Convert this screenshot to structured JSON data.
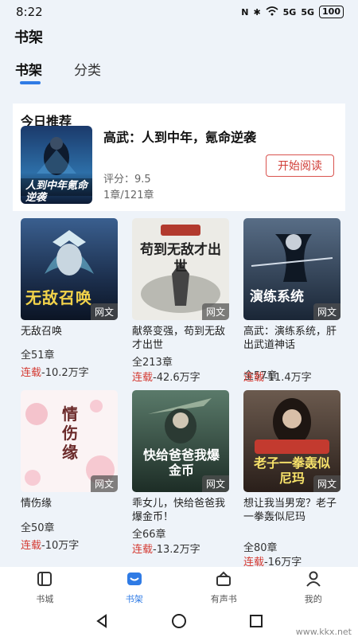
{
  "status_bar": {
    "time": "8:22",
    "signal1": "5G",
    "signal2": "5G",
    "battery": "100"
  },
  "app": {
    "title": "书架"
  },
  "tabs": [
    {
      "label": "书架",
      "active": true
    },
    {
      "label": "分类",
      "active": false
    }
  ],
  "recommend": {
    "heading": "今日推荐",
    "title": "高武：人到中年，氪命逆袭",
    "rating": "评分：9.5",
    "chapters": "1章/121章",
    "button": "开始阅读",
    "cover_text": "人到中年氪命逆袭"
  },
  "books": [
    {
      "title": "无敌召唤",
      "chapters": "全51章",
      "status": "连载",
      "words": "-10.2万字",
      "cover_text": "无敌召唤",
      "badge": "网文"
    },
    {
      "title": "献祭变强，苟到无敌才出世",
      "chapters": "全213章",
      "status": "连载",
      "words": "-42.6万字",
      "cover_text": "苟到无敌才出世",
      "badge": "网文"
    },
    {
      "title": "高武：演练系统，肝出武道神话",
      "chapters": "全57章",
      "status": "连载",
      "words": "-11.4万字",
      "cover_text": "演练系统",
      "badge": "网文"
    },
    {
      "title": "情伤缘",
      "chapters": "全50章",
      "status": "连载",
      "words": "-10万字",
      "cover_text": "情伤缘",
      "badge": "网文"
    },
    {
      "title": "乖女儿，快给爸爸我爆金币！",
      "chapters": "全66章",
      "status": "连载",
      "words": "-13.2万字",
      "cover_text": "快给爸爸我爆金币",
      "badge": "网文"
    },
    {
      "title": "想让我当男宠？老子一拳轰似尼玛",
      "chapters": "全80章",
      "status": "连载",
      "words": "-16万字",
      "cover_text": "老子一拳轰似尼玛",
      "badge": "网文"
    }
  ],
  "bottom_nav": [
    {
      "label": "书城",
      "icon": "book-store-icon",
      "active": false
    },
    {
      "label": "书架",
      "icon": "bookshelf-icon",
      "active": true
    },
    {
      "label": "有声书",
      "icon": "audio-book-icon",
      "active": false
    },
    {
      "label": "我的",
      "icon": "profile-icon",
      "active": false
    }
  ],
  "watermark": "www.kkx.net",
  "colors": {
    "accent": "#2f7be5",
    "serial_red": "#d43a32"
  }
}
